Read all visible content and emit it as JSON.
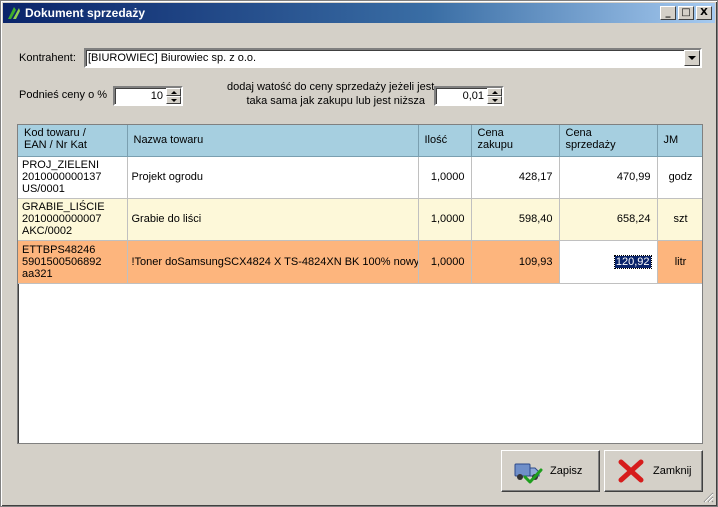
{
  "window": {
    "title": "Dokument sprzedaży",
    "icon": "app-logo-icon",
    "controls": {
      "minimize": "_",
      "maximize": "□",
      "close": "X"
    }
  },
  "kontrahent": {
    "label": "Kontrahent:",
    "value": "[BIUROWIEC] Biurowiec sp. z o.o."
  },
  "raise": {
    "label": "Podnieś ceny o %",
    "value": "10"
  },
  "threshold": {
    "label_line1": "dodaj watość do ceny sprzedaży jeżeli jest",
    "label_line2": "taka sama jak zakupu lub jest niższa",
    "value": "0,01"
  },
  "grid": {
    "columns": [
      "Kod towaru /\nEAN / Nr Kat",
      "Nazwa towaru",
      "Ilość",
      "Cena\nzakupu",
      "Cena\nsprzedaży",
      "JM"
    ],
    "rows": [
      {
        "kod": "PROJ_ZIELENI\n2010000000137\nUS/0001",
        "nazwa": "Projekt ogrodu",
        "ilosc": "1,0000",
        "zakup": "428,17",
        "sprzedaz": "470,99",
        "jm": "godz"
      },
      {
        "kod": "GRABIE_LIŚCIE\n2010000000007\nAKC/0002",
        "nazwa": "Grabie do liści",
        "ilosc": "1,0000",
        "zakup": "598,40",
        "sprzedaz": "658,24",
        "jm": "szt"
      },
      {
        "kod": "ETTBPS48246\n5901500506892\naa321",
        "nazwa": "!Toner doSamsungSCX4824 X TS-4824XN BK 100% nowy",
        "ilosc": "1,0000",
        "zakup": "109,93",
        "sprzedaz": "120,92",
        "jm": "litr"
      }
    ]
  },
  "buttons": {
    "save": "Zapisz",
    "close": "Zamknij"
  },
  "colors": {
    "header_bg": "#a6cfe0",
    "row_white": "#ffffff",
    "row_cream": "#fdf8d9",
    "row_selected": "#fdb57d",
    "selection": "#0a246a"
  }
}
